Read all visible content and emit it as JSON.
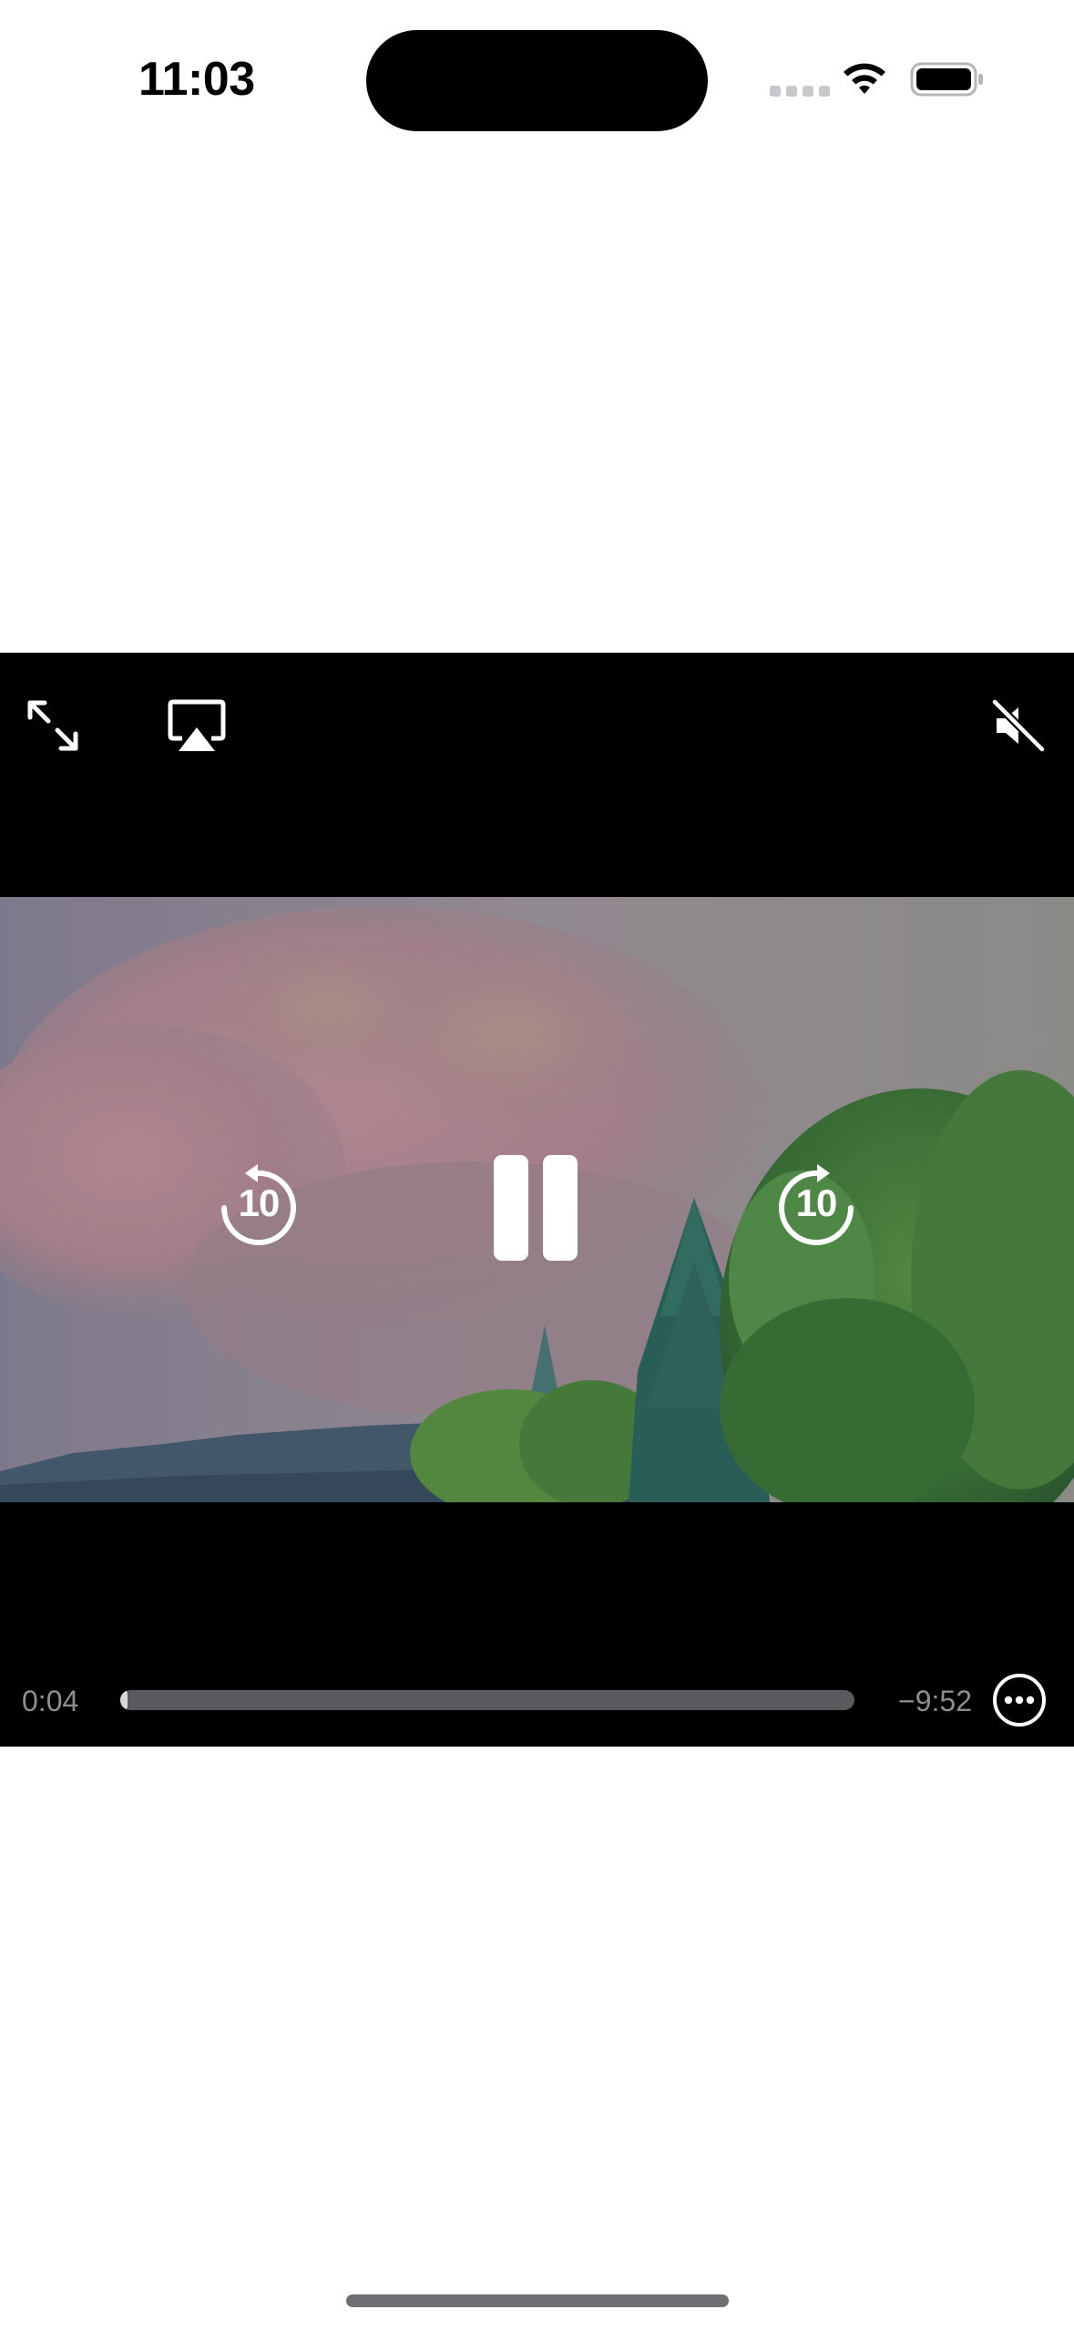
{
  "status_bar": {
    "time": "11:03",
    "wifi_icon": "wifi-icon",
    "battery_icon": "battery-full-icon"
  },
  "player": {
    "top_controls": {
      "fullscreen_icon": "expand-arrows-icon",
      "airplay_icon": "airplay-icon",
      "mute_icon": "speaker-muted-icon"
    },
    "center_controls": {
      "skip_back_seconds": "10",
      "skip_forward_seconds": "10",
      "pause_icon": "pause-icon"
    },
    "timeline": {
      "elapsed": "0:04",
      "remaining": "−9:52",
      "progress_fraction": 0.007
    },
    "more_icon": "ellipsis-circle-icon"
  },
  "colors": {
    "player_background": "#000000",
    "control_tint": "#ffffff",
    "time_text": "#8e8e93",
    "scrubber_track": "#5a5a5e",
    "scrubber_fill": "#d8d8dc"
  }
}
